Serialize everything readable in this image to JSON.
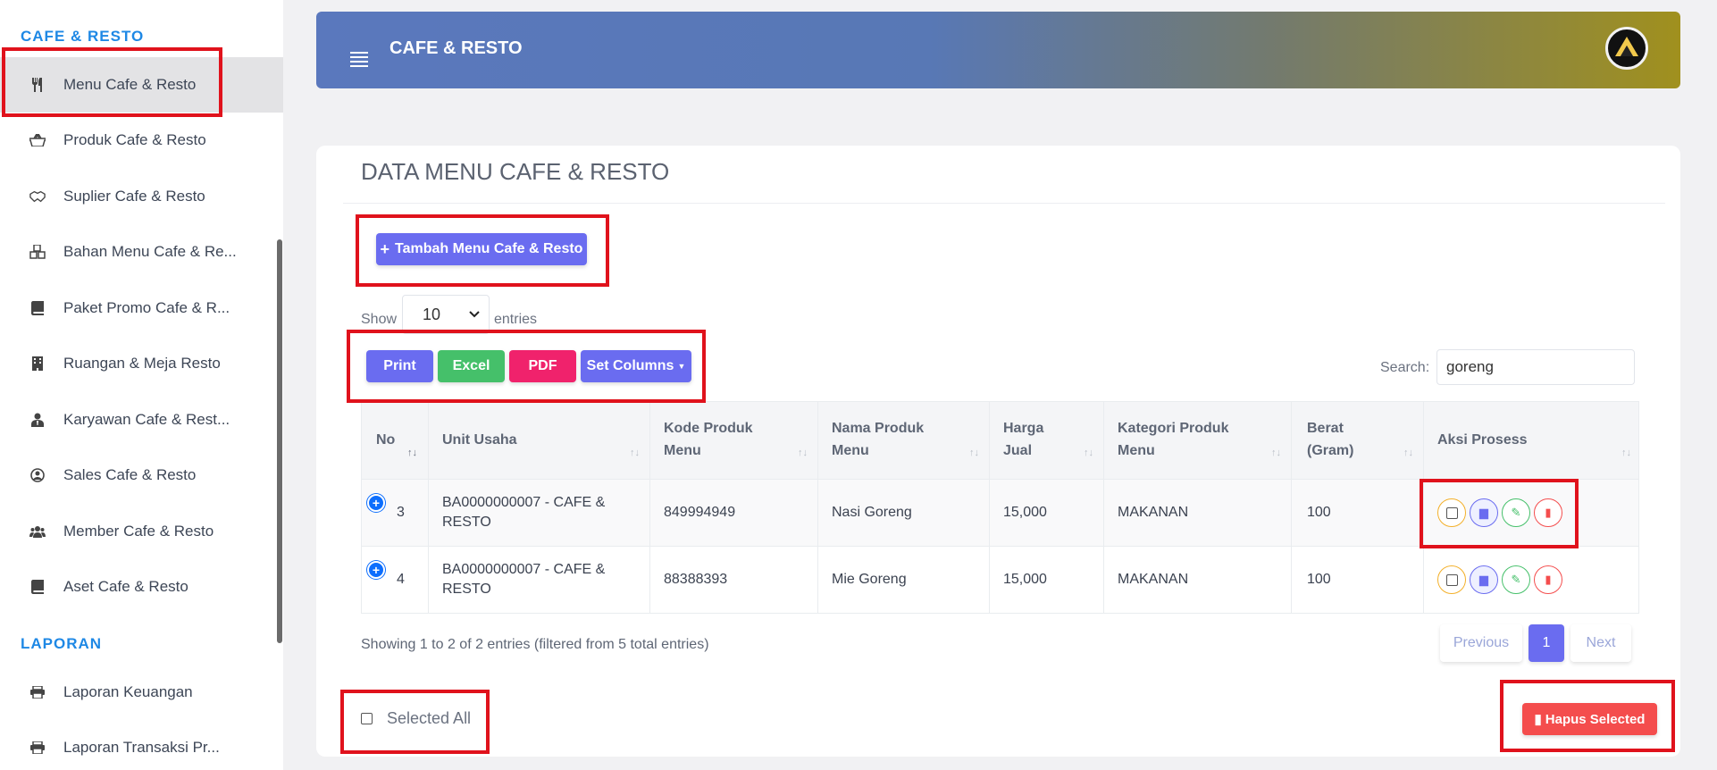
{
  "sidebar": {
    "section_1": "CAFE & RESTO",
    "section_2": "LAPORAN",
    "items": [
      {
        "label": "Menu Cafe & Resto",
        "icon": "utensils-icon"
      },
      {
        "label": "Produk Cafe & Resto",
        "icon": "basket-icon"
      },
      {
        "label": "Suplier Cafe & Resto",
        "icon": "handshake-icon"
      },
      {
        "label": "Bahan Menu Cafe & Re...",
        "icon": "cubes-icon"
      },
      {
        "label": "Paket Promo Cafe & R...",
        "icon": "book-icon"
      },
      {
        "label": "Ruangan & Meja Resto",
        "icon": "building-icon"
      },
      {
        "label": "Karyawan Cafe & Rest...",
        "icon": "user-tie-icon"
      },
      {
        "label": "Sales Cafe & Resto",
        "icon": "user-circle-icon"
      },
      {
        "label": "Member Cafe & Resto",
        "icon": "users-icon"
      },
      {
        "label": "Aset Cafe & Resto",
        "icon": "book-icon"
      }
    ],
    "report_items": [
      {
        "label": "Laporan Keuangan",
        "icon": "print-icon"
      },
      {
        "label": "Laporan Transaksi Pr...",
        "icon": "print-icon"
      }
    ]
  },
  "header": {
    "title": "CAFE & RESTO"
  },
  "main": {
    "title": "DATA MENU CAFE & RESTO",
    "add_button": "Tambah Menu Cafe & Resto",
    "show_label": "Show",
    "entries_label": "entries",
    "page_length": "10",
    "export_buttons": {
      "print": "Print",
      "excel": "Excel",
      "pdf": "PDF",
      "columns": "Set Columns"
    },
    "search_label": "Search:",
    "search_value": "goreng",
    "columns": [
      "No",
      "Unit Usaha",
      "Kode Produk Menu",
      "Nama Produk Menu",
      "Harga Jual",
      "Kategori Produk Menu",
      "Berat (Gram)",
      "Aksi Prosess"
    ],
    "column_lines": {
      "kode": [
        "Kode Produk",
        "Menu"
      ],
      "nama": [
        "Nama Produk",
        "Menu"
      ],
      "harga": [
        "Harga",
        "Jual"
      ],
      "kategori": [
        "Kategori Produk",
        "Menu"
      ],
      "berat": [
        "Berat",
        "(Gram)"
      ]
    },
    "rows": [
      {
        "no": "3",
        "unit_line1": "BA0000000007 - CAFE &",
        "unit_line2": "RESTO",
        "kode": "849994949",
        "nama": "Nasi Goreng",
        "harga": "15,000",
        "kategori": "MAKANAN",
        "berat": "100"
      },
      {
        "no": "4",
        "unit_line1": "BA0000000007 - CAFE &",
        "unit_line2": "RESTO",
        "kode": "88388393",
        "nama": "Mie Goreng",
        "harga": "15,000",
        "kategori": "MAKANAN",
        "berat": "100"
      }
    ],
    "info": "Showing 1 to 2 of 2 entries (filtered from 5 total entries)",
    "pagination": {
      "previous": "Previous",
      "page": "1",
      "next": "Next"
    },
    "select_all": "Selected All",
    "delete_selected": "Hapus Selected"
  },
  "colors": {
    "accent": "#6a6cf0",
    "section": "#1e88e5",
    "highlight": "#e0121c"
  }
}
